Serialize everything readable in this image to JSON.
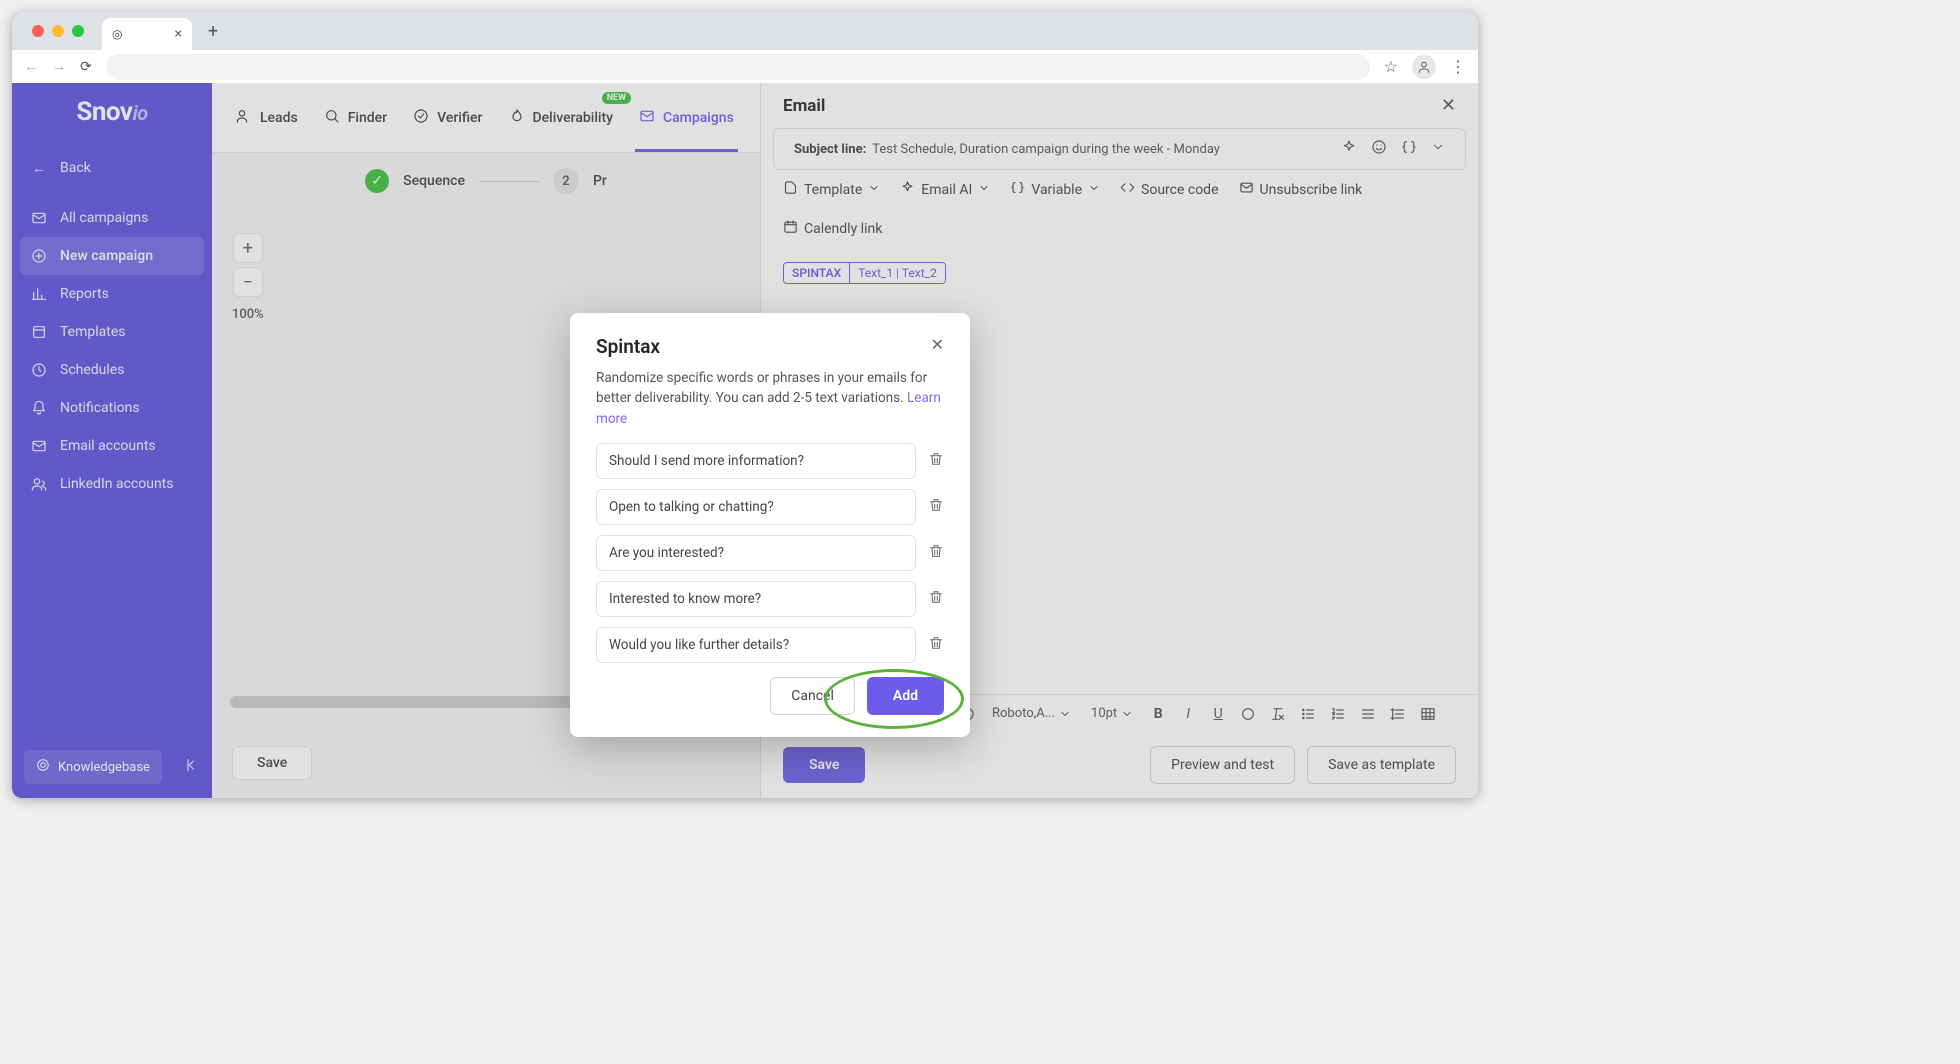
{
  "browser": {
    "new_tab_plus": "+",
    "tab_close": "×"
  },
  "sidebar": {
    "logo": "Snov",
    "logo_suffix": "io",
    "back": "Back",
    "items": [
      "All campaigns",
      "New campaign",
      "Reports",
      "Templates",
      "Schedules",
      "Notifications",
      "Email accounts",
      "LinkedIn accounts"
    ],
    "knowledgebase": "Knowledgebase"
  },
  "topnav": {
    "items": [
      "Leads",
      "Finder",
      "Verifier",
      "Deliverability",
      "Campaigns"
    ],
    "badge": "NEW"
  },
  "stepper": {
    "step1": "Sequence",
    "step2_num": "2",
    "step2": "Pr"
  },
  "zoom": {
    "plus": "+",
    "minus": "−",
    "label": "100%"
  },
  "canvas": {
    "save": "Save"
  },
  "panel": {
    "title": "Email",
    "subject_label": "Subject line:",
    "subject_value": "Test Schedule, Duration campaign during the week - Monday",
    "toolbar": [
      "Template",
      "Email AI",
      "Variable",
      "Source code",
      "Unsubscribe link",
      "Calendly link"
    ],
    "chip_a": "SPINTAX",
    "chip_b": "Text_1 | Text_2",
    "font": "Roboto,A...",
    "size": "10pt",
    "save": "Save",
    "preview": "Preview and test",
    "template": "Save as template"
  },
  "modal": {
    "title": "Spintax",
    "description": "Randomize specific words or phrases in your emails for better deliverability. You can add 2-5 text variations. ",
    "learn_more": "Learn more",
    "variants": [
      "Should I send more information?",
      "Open to talking or chatting?",
      "Are you interested?",
      "Interested to know more?",
      "Would you like further details?"
    ],
    "cancel": "Cancel",
    "add": "Add"
  }
}
